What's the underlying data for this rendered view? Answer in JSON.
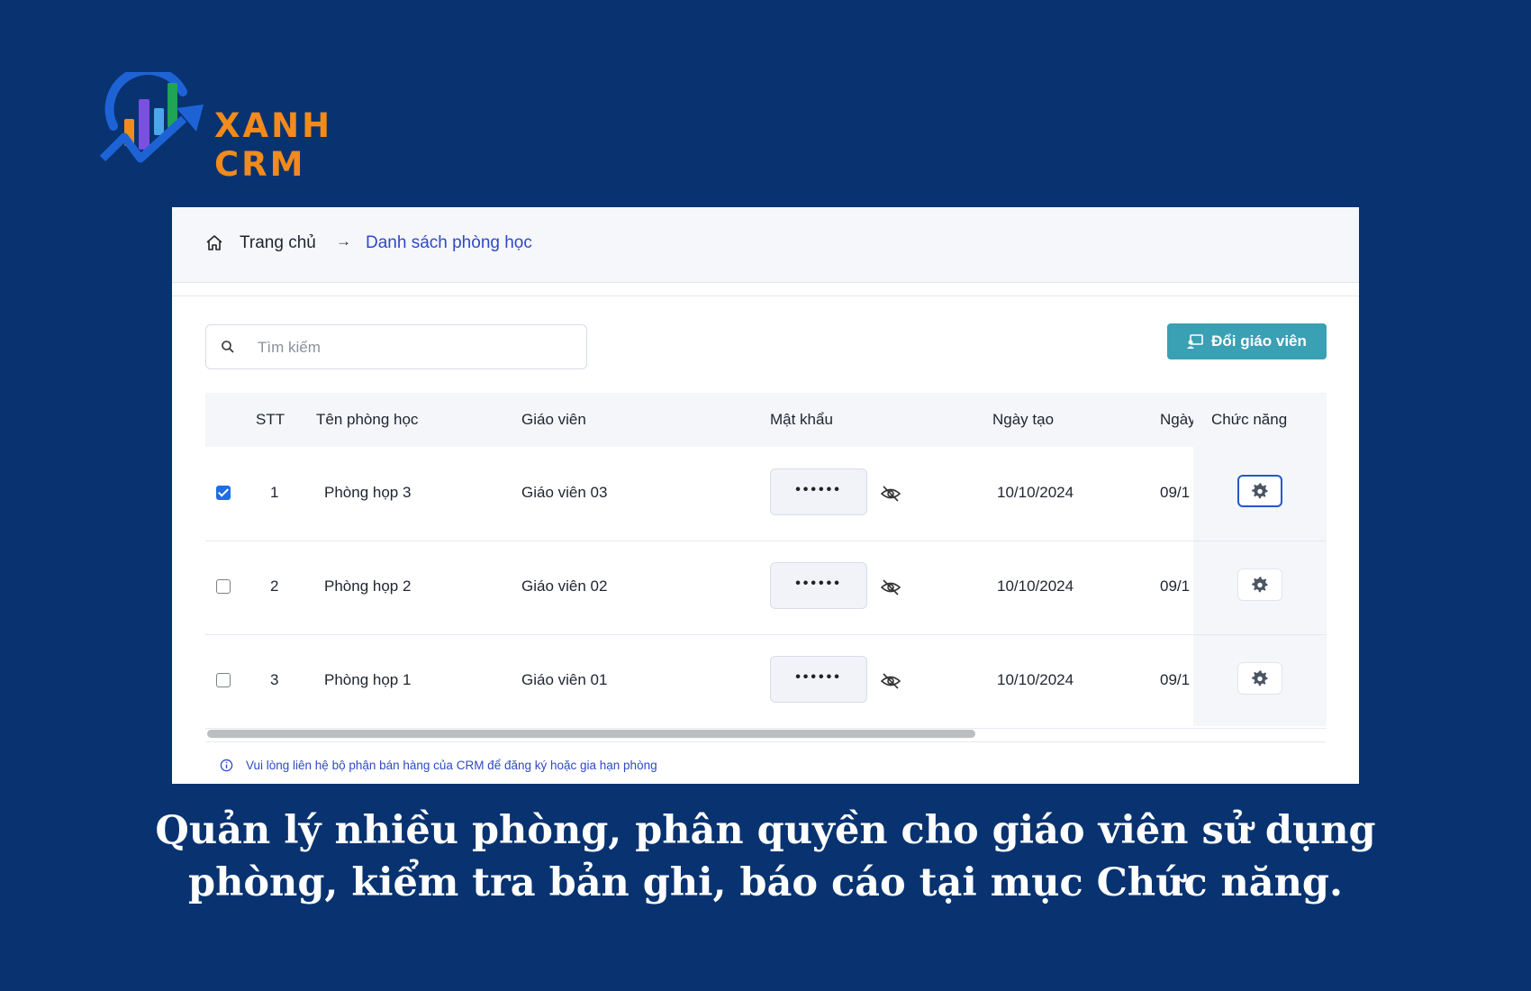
{
  "brand": {
    "name": "XANH CRM",
    "accent": "#f38a1c",
    "background": "#083370"
  },
  "breadcrumb": {
    "home_icon": "home-icon",
    "home": "Trang chủ",
    "separator": "→",
    "current": "Danh sách phòng học"
  },
  "search": {
    "placeholder": "Tìm kiếm",
    "value": ""
  },
  "actions": {
    "change_teacher": "Đổi giáo viên"
  },
  "table": {
    "headers": {
      "stt": "STT",
      "room": "Tên phòng học",
      "teacher": "Giáo viên",
      "password": "Mật khẩu",
      "created": "Ngày tạo",
      "next": "Ngày",
      "actions": "Chức năng"
    },
    "rows": [
      {
        "checked": true,
        "stt": "1",
        "room": "Phòng họp 3",
        "teacher": "Giáo viên 03",
        "password": "••••••",
        "created": "10/10/2024",
        "next": "09/1"
      },
      {
        "checked": false,
        "stt": "2",
        "room": "Phòng họp 2",
        "teacher": "Giáo viên 02",
        "password": "••••••",
        "created": "10/10/2024",
        "next": "09/1"
      },
      {
        "checked": false,
        "stt": "3",
        "room": "Phòng họp 1",
        "teacher": "Giáo viên 01",
        "password": "••••••",
        "created": "10/10/2024",
        "next": "09/1"
      }
    ]
  },
  "notice": "Vui lòng liên hệ bộ phận bán hàng của CRM để đăng ký hoặc gia hạn phòng",
  "caption": {
    "line1": "Quản lý nhiều phòng, phân quyền cho giáo viên sử dụng",
    "line2": "phòng, kiểm tra bản ghi, báo cáo tại mục Chức năng."
  }
}
